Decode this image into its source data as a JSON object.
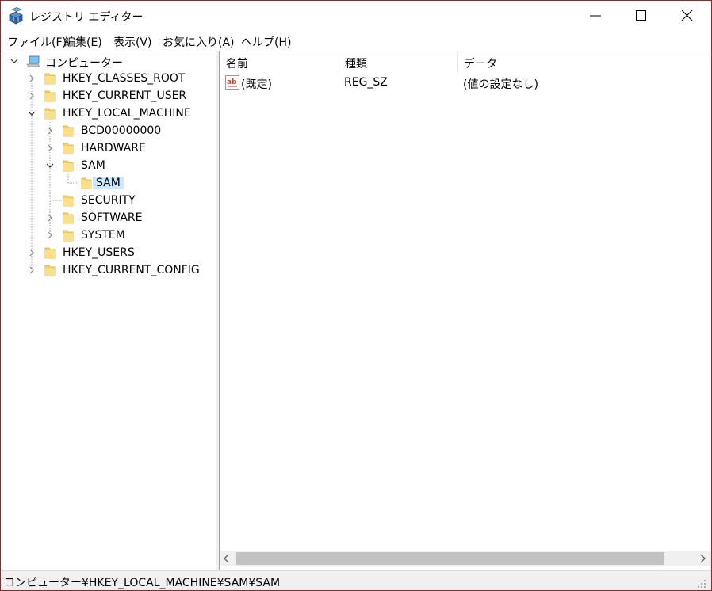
{
  "window": {
    "title": "レジストリ エディター",
    "icon": "regedit-icon",
    "border_color": "#8c2b2b"
  },
  "menu": {
    "items": [
      {
        "label": "ファイル(F)"
      },
      {
        "label": "編集(E)"
      },
      {
        "label": "表示(V)"
      },
      {
        "label": "お気に入り(A)"
      },
      {
        "label": "ヘルプ(H)"
      }
    ]
  },
  "tree": {
    "root_label": "コンピューター",
    "nodes": [
      {
        "label": "HKEY_CLASSES_ROOT",
        "expanded": false
      },
      {
        "label": "HKEY_CURRENT_USER",
        "expanded": false
      },
      {
        "label": "HKEY_LOCAL_MACHINE",
        "expanded": true
      },
      {
        "label": "BCD00000000",
        "expanded": false
      },
      {
        "label": "HARDWARE",
        "expanded": false
      },
      {
        "label": "SAM",
        "expanded": true
      },
      {
        "label": "SAM",
        "selected": true
      },
      {
        "label": "SECURITY"
      },
      {
        "label": "SOFTWARE",
        "expanded": false
      },
      {
        "label": "SYSTEM",
        "expanded": false
      },
      {
        "label": "HKEY_USERS",
        "expanded": false
      },
      {
        "label": "HKEY_CURRENT_CONFIG",
        "expanded": false
      }
    ],
    "selection_color": "#cce8ff"
  },
  "list": {
    "columns": [
      "名前",
      "種類",
      "データ"
    ],
    "rows": [
      {
        "name": "(既定)",
        "type": "REG_SZ",
        "data": "(値の設定なし)",
        "icon": "string-value-icon"
      }
    ]
  },
  "status": {
    "path": "コンピューター¥HKEY_LOCAL_MACHINE¥SAM¥SAM"
  }
}
